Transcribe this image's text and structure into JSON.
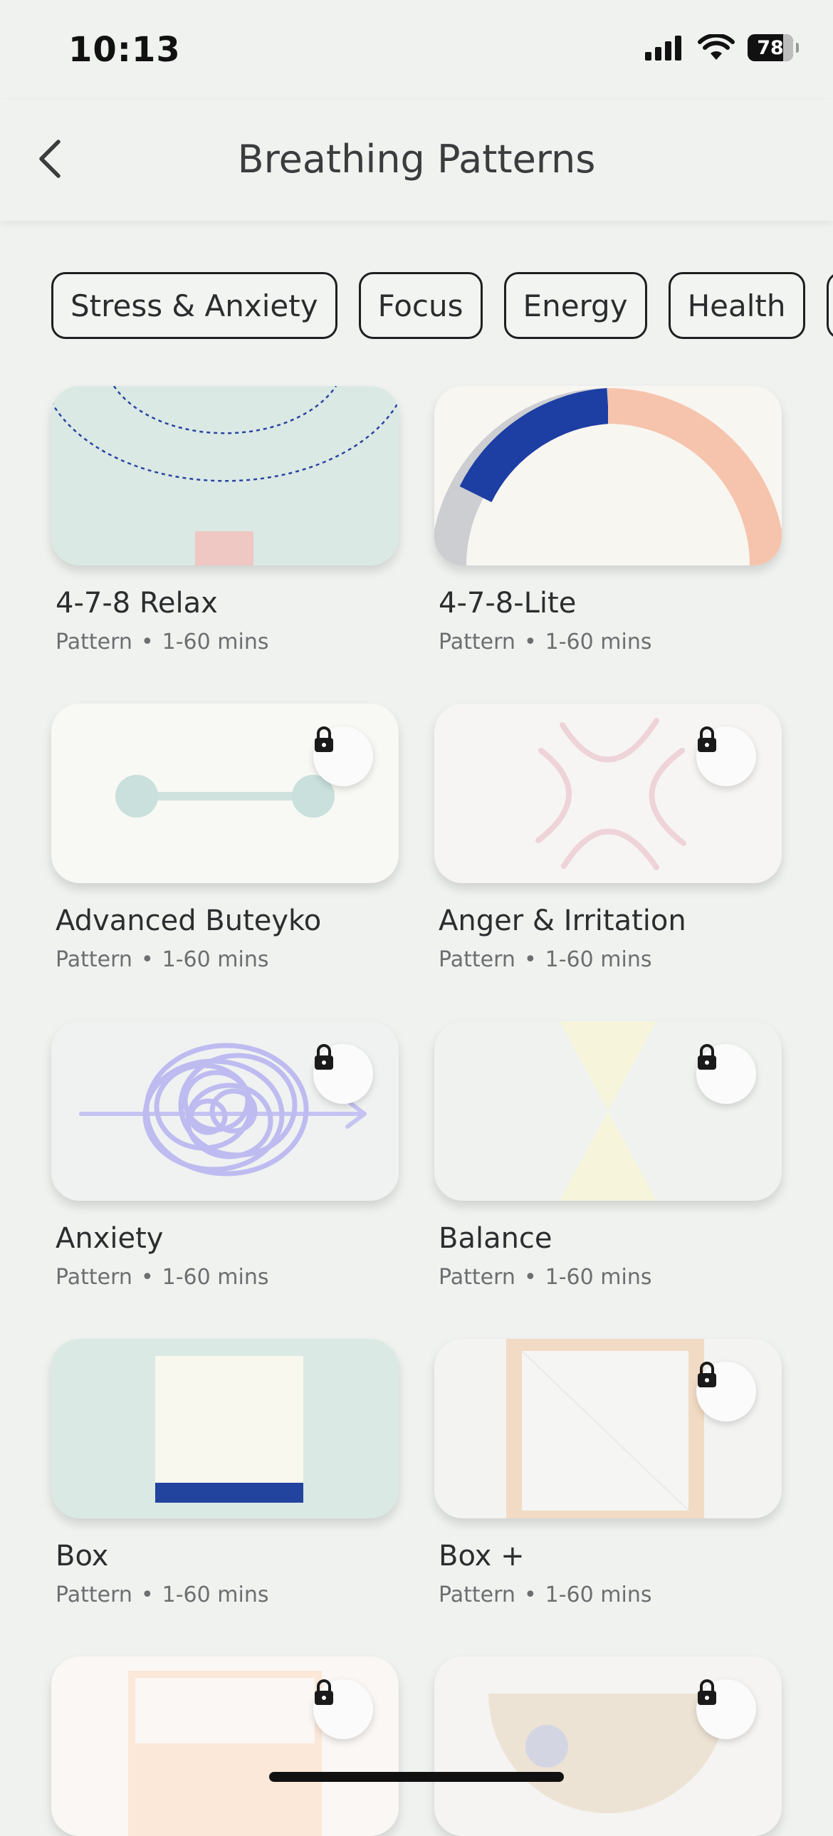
{
  "status_bar": {
    "time": "10:13",
    "battery_level": "78",
    "icons": [
      "cellular-signal-icon",
      "wifi-icon",
      "battery-icon"
    ]
  },
  "header": {
    "title": "Breathing Patterns",
    "back_icon": "chevron-left-icon"
  },
  "categories": [
    "Stress & Anxiety",
    "Focus",
    "Energy",
    "Health"
  ],
  "meta_separator": "•",
  "patterns": [
    {
      "name": "4-7-8 Relax",
      "type": "Pattern",
      "duration": "1-60 mins",
      "locked": false
    },
    {
      "name": "4-7-8-Lite",
      "type": "Pattern",
      "duration": "1-60 mins",
      "locked": false
    },
    {
      "name": "Advanced Buteyko",
      "type": "Pattern",
      "duration": "1-60 mins",
      "locked": true
    },
    {
      "name": "Anger & Irritation",
      "type": "Pattern",
      "duration": "1-60 mins",
      "locked": true
    },
    {
      "name": "Anxiety",
      "type": "Pattern",
      "duration": "1-60 mins",
      "locked": true
    },
    {
      "name": "Balance",
      "type": "Pattern",
      "duration": "1-60 mins",
      "locked": true
    },
    {
      "name": "Box",
      "type": "Pattern",
      "duration": "1-60 mins",
      "locked": false
    },
    {
      "name": "Box +",
      "type": "Pattern",
      "duration": "1-60 mins",
      "locked": true
    },
    {
      "name": "",
      "type": "",
      "duration": "",
      "locked": true
    },
    {
      "name": "",
      "type": "",
      "duration": "",
      "locked": true
    }
  ],
  "colors": {
    "background": "#eff2ef",
    "accent_blue": "#2a44a0",
    "peach": "#f6c4ad",
    "mint": "#dbe9e5"
  }
}
